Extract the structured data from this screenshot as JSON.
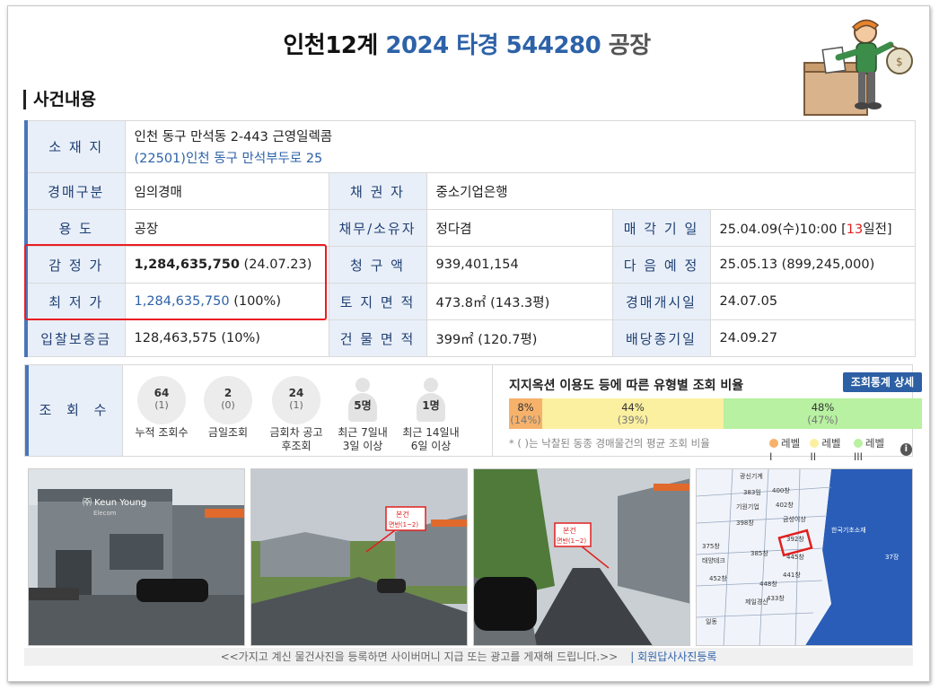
{
  "header": {
    "court": "인천12계",
    "case_no": "2024 타경 544280",
    "kind": "공장"
  },
  "section_title": "사건내용",
  "info": {
    "address": {
      "label": "소 재 지",
      "line1": "인천 동구 만석동 2-443 근영일렉콤",
      "line2": "(22501)인천 동구  만석부두로  25"
    },
    "auction_type": {
      "label": "경매구분",
      "value": "임의경매"
    },
    "creditor": {
      "label": "채 권 자",
      "value": "중소기업은행"
    },
    "usage": {
      "label": "용      도",
      "value": "공장"
    },
    "debtor": {
      "label": "채무/소유자",
      "value": "정다겸"
    },
    "sale_date": {
      "label": "매 각 기 일",
      "value": "25.04.09(수)10:00 [",
      "days": "13",
      "suffix": "일전]"
    },
    "appraisal": {
      "label": "감 정 가",
      "amount": "1,284,635,750",
      "date": " (24.07.23)"
    },
    "claim": {
      "label": "청 구 액",
      "value": "939,401,154"
    },
    "next_sale": {
      "label": "다 음 예 정",
      "value": "25.05.13 (899,245,000)"
    },
    "minimum": {
      "label": "최 저 가",
      "amount": "1,284,635,750",
      "pct": " (100%)"
    },
    "land_area": {
      "label": "토 지 면 적",
      "value": "473.8㎡ (143.3평)"
    },
    "start_date": {
      "label": "경매개시일",
      "value": "24.07.05"
    },
    "deposit": {
      "label": "입찰보증금",
      "value": "128,463,575 (10%)"
    },
    "building_area": {
      "label": "건 물 면 적",
      "value": "399㎡ (120.7평)"
    },
    "dividend_end": {
      "label": "배당종기일",
      "value": "24.09.27"
    }
  },
  "views": {
    "label": "조 회 수",
    "stats": [
      {
        "num": "64",
        "sub": "(1)",
        "caption": "누적 조회수"
      },
      {
        "num": "2",
        "sub": "(0)",
        "caption": "금일조회"
      },
      {
        "num": "24",
        "sub": "(1)",
        "caption": "금회차 공고후조회"
      }
    ],
    "people": [
      {
        "num": "5명",
        "caption": "최근 7일내 3일 이상"
      },
      {
        "num": "1명",
        "caption": "최근 14일내 6일 이상"
      }
    ]
  },
  "ratio": {
    "title": "지지옥션 이용도 등에 따른 유형별 조회 비율",
    "button": "조회통계 상세",
    "bars": [
      {
        "pct": "8%",
        "avg": "(14%)",
        "share": 0.08,
        "color": "#f6b26b"
      },
      {
        "pct": "44%",
        "avg": "(39%)",
        "share": 0.44,
        "color": "#fbf0a0"
      },
      {
        "pct": "48%",
        "avg": "(47%)",
        "share": 0.48,
        "color": "#b7f1a1"
      }
    ],
    "note": "* ( )는 낙찰된 동종 경매물건의 평균 조회 비율",
    "legend": [
      "레벨 I",
      "레벨 II",
      "레벨 III"
    ]
  },
  "photos": {
    "sign_text": "㈜ Keun Young",
    "sign_sub": "Elecom",
    "tag_text": "본건",
    "tag_sub": "면반(1~2)",
    "map_labels": [
      "광신기계",
      "383임",
      "기원기업",
      "398창",
      "400창",
      "402창",
      "금성이상",
      "392창",
      "445창",
      "375창",
      "385창",
      "441창",
      "452창",
      "448창",
      "433창",
      "태양테크",
      "제일경산",
      "일동",
      "한국기초소재",
      "37장"
    ]
  },
  "footer": {
    "text": "<<가지고 계신 물건사진을 등록하면 사이버머니 지급 또는 광고를 게재해 드립니다.>>",
    "link": "| 회원답사사진등록"
  }
}
